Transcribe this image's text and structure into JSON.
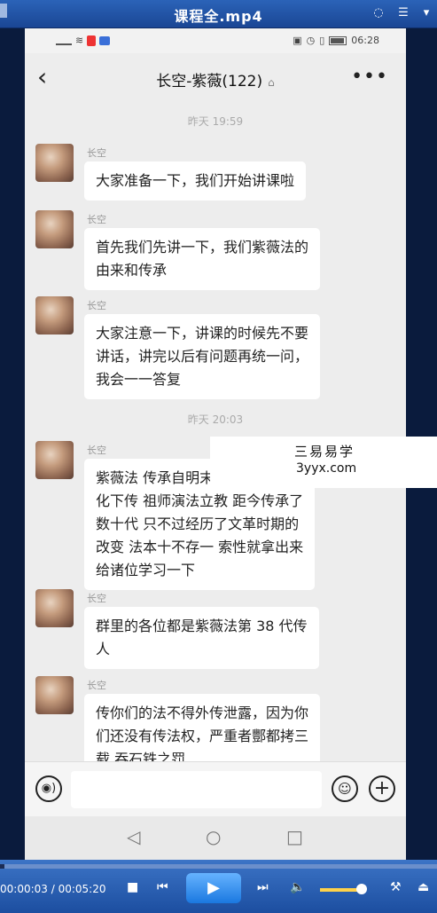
{
  "player": {
    "title": "课程全.mp4",
    "time": "00:00:03 / 00:05:20",
    "progress_fraction": 0.01,
    "volume_fraction": 0.9
  },
  "phone": {
    "status_time": "06:28",
    "chat_title": "长空-紫薇(122)",
    "timestamps": [
      "昨天 19:59",
      "昨天 20:03"
    ],
    "messages": [
      {
        "sender": "长空",
        "text_lines": [
          "大家准备一下，我们开始讲课啦"
        ]
      },
      {
        "sender": "长空",
        "text_lines": [
          "首先我们先讲一下，我们紫薇法的",
          "由来和传承"
        ]
      },
      {
        "sender": "长空",
        "text_lines": [
          "大家注意一下，讲课的时候先不要",
          "讲话，讲完以后有问题再统一问，",
          "我会一一答复"
        ]
      },
      {
        "sender": "长空",
        "text_lines": [
          "紫薇法 传承自明末时期茅山法衍",
          "化下传 祖师演法立教 距今传承了",
          "数十代 只不过经历了文革时期的",
          "改变 法本十不存一 索性就拿出来",
          "给诸位学习一下"
        ]
      },
      {
        "sender": "长空",
        "text_lines": [
          "群里的各位都是紫薇法第 38 代传",
          "人"
        ]
      },
      {
        "sender": "长空",
        "text_lines": [
          "传你们的法不得外传泄露，因为你",
          "们还没有传法权，严重者酆都拷三",
          "载 吞石铁之罚"
        ]
      }
    ]
  },
  "watermark": {
    "line1": "三易易学",
    "line2": "3yyx.com"
  },
  "icons": {
    "back": "chevron-left-icon",
    "more": "more-dots-icon",
    "voice": "voice-icon",
    "emoji": "emoji-icon",
    "add": "plus-icon"
  }
}
